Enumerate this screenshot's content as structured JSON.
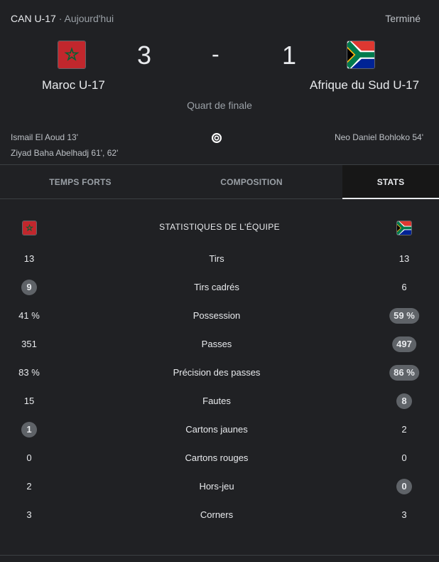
{
  "header": {
    "competition": "CAN U-17",
    "separator": "·",
    "date": "Aujourd'hui",
    "status": "Terminé"
  },
  "match": {
    "home": {
      "name": "Maroc U-17",
      "score": "3",
      "flag": "morocco-flag"
    },
    "away": {
      "name": "Afrique du Sud U-17",
      "score": "1",
      "flag": "south-africa-flag"
    },
    "score_separator": "-",
    "round": "Quart de finale"
  },
  "scorers": {
    "home": [
      "Ismail El Aoud 13'",
      "Ziyad Baha Abelhadj 61', 62'"
    ],
    "away": [
      "Neo Daniel Bohloko 54'"
    ],
    "icon": "soccer-ball-icon"
  },
  "tabs": [
    {
      "label": "TEMPS FORTS",
      "active": false
    },
    {
      "label": "COMPOSITION",
      "active": false
    },
    {
      "label": "STATS",
      "active": true
    }
  ],
  "stats": {
    "title": "STATISTIQUES DE L'ÉQUIPE",
    "rows": [
      {
        "label": "Tirs",
        "home": "13",
        "away": "13",
        "highlight": "none"
      },
      {
        "label": "Tirs cadrés",
        "home": "9",
        "away": "6",
        "highlight": "home"
      },
      {
        "label": "Possession",
        "home": "41 %",
        "away": "59 %",
        "highlight": "away"
      },
      {
        "label": "Passes",
        "home": "351",
        "away": "497",
        "highlight": "away"
      },
      {
        "label": "Précision des passes",
        "home": "83 %",
        "away": "86 %",
        "highlight": "away"
      },
      {
        "label": "Fautes",
        "home": "15",
        "away": "8",
        "highlight": "away"
      },
      {
        "label": "Cartons jaunes",
        "home": "1",
        "away": "2",
        "highlight": "home"
      },
      {
        "label": "Cartons rouges",
        "home": "0",
        "away": "0",
        "highlight": "none"
      },
      {
        "label": "Hors-jeu",
        "home": "2",
        "away": "0",
        "highlight": "away"
      },
      {
        "label": "Corners",
        "home": "3",
        "away": "3",
        "highlight": "none"
      }
    ]
  },
  "colors": {
    "background": "#202124",
    "text": "#e8eaed",
    "muted": "#9aa0a6",
    "pill": "#5f6368",
    "active_tab_bg": "#171717"
  }
}
